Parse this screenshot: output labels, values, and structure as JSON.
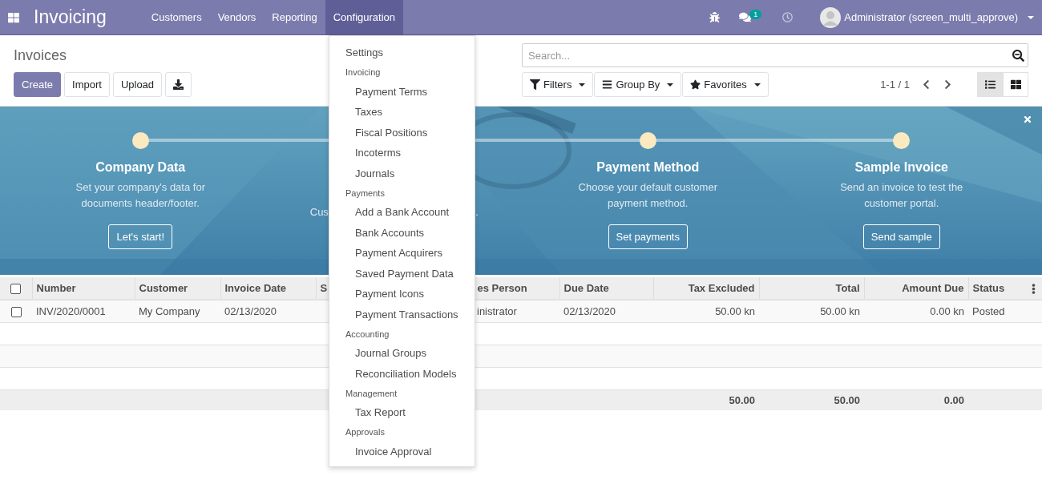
{
  "navbar": {
    "app_title": "Invoicing",
    "menus": [
      {
        "label": "Customers",
        "selected": false
      },
      {
        "label": "Vendors",
        "selected": false
      },
      {
        "label": "Reporting",
        "selected": false
      },
      {
        "label": "Configuration",
        "selected": true
      }
    ],
    "chat_badge": "1",
    "user": "Administrator (screen_multi_approve)"
  },
  "control_panel": {
    "title": "Invoices",
    "buttons": [
      {
        "label": "Create",
        "kind": "primary"
      },
      {
        "label": "Import",
        "kind": "secondary"
      },
      {
        "label": "Upload",
        "kind": "secondary"
      }
    ],
    "search": {
      "placeholder": "Search..."
    },
    "filters": [
      {
        "label": "Filters",
        "kind": "filter"
      },
      {
        "label": "Group By",
        "kind": "group"
      },
      {
        "label": "Favorites",
        "kind": "star"
      }
    ],
    "pager": "1-1 / 1",
    "views": [
      {
        "kind": "list",
        "selected": true
      },
      {
        "kind": "kanban",
        "selected": false
      }
    ]
  },
  "banner": {
    "steps": [
      {
        "title": "Company Data",
        "description": [
          "Set your company's data for",
          "documents header/footer."
        ],
        "button": "Let's start!"
      },
      {
        "fragments": [
          "Cus",
          "."
        ]
      },
      {
        "title": "Payment Method",
        "description": [
          "Choose your default customer",
          "payment method."
        ],
        "button": "Set payments"
      },
      {
        "title": "Sample Invoice",
        "description": [
          "Send an invoice to test the",
          "customer portal."
        ],
        "button": "Send sample"
      }
    ]
  },
  "table": {
    "select_all": {
      "checked": false
    },
    "columns": [
      {
        "label": "Number",
        "kind": "text"
      },
      {
        "label": "Customer",
        "kind": "text"
      },
      {
        "label": "Invoice Date",
        "kind": "text"
      },
      {
        "label": "S",
        "kind": "text"
      },
      {
        "label": "es Person",
        "kind": "text"
      },
      {
        "label": "Due Date",
        "kind": "text"
      },
      {
        "label": "Tax Excluded",
        "kind": "number",
        "total": "50.00"
      },
      {
        "label": "Total",
        "kind": "number",
        "total": "50.00"
      },
      {
        "label": "Amount Due",
        "kind": "number",
        "total": "0.00"
      },
      {
        "label": "Status",
        "kind": "text"
      }
    ],
    "rows": [
      {
        "checked": false,
        "cells": [
          "INV/2020/0001",
          "My Company",
          "02/13/2020",
          null,
          "inistrator",
          "02/13/2020",
          "50.00 kn",
          "50.00 kn",
          "0.00 kn",
          "Posted"
        ]
      }
    ]
  },
  "menu": {
    "items": [
      {
        "kind": "entry",
        "label": "Settings"
      },
      {
        "kind": "header",
        "label": "Invoicing"
      },
      {
        "kind": "subentry",
        "label": "Payment Terms"
      },
      {
        "kind": "subentry",
        "label": "Taxes"
      },
      {
        "kind": "subentry",
        "label": "Fiscal Positions"
      },
      {
        "kind": "subentry",
        "label": "Incoterms"
      },
      {
        "kind": "subentry",
        "label": "Journals"
      },
      {
        "kind": "header",
        "label": "Payments"
      },
      {
        "kind": "subentry",
        "label": "Add a Bank Account"
      },
      {
        "kind": "subentry",
        "label": "Bank Accounts"
      },
      {
        "kind": "subentry",
        "label": "Payment Acquirers"
      },
      {
        "kind": "subentry",
        "label": "Saved Payment Data"
      },
      {
        "kind": "subentry",
        "label": "Payment Icons"
      },
      {
        "kind": "subentry",
        "label": "Payment Transactions"
      },
      {
        "kind": "header",
        "label": "Accounting"
      },
      {
        "kind": "subentry",
        "label": "Journal Groups"
      },
      {
        "kind": "subentry",
        "label": "Reconciliation Models"
      },
      {
        "kind": "header",
        "label": "Management"
      },
      {
        "kind": "subentry",
        "label": "Tax Report"
      },
      {
        "kind": "header",
        "label": "Approvals"
      },
      {
        "kind": "subentry",
        "label": "Invoice Approval"
      }
    ]
  }
}
